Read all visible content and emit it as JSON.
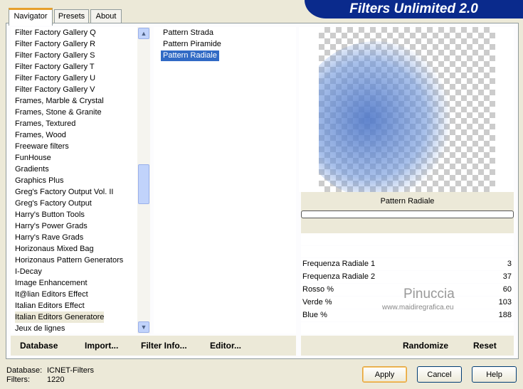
{
  "title": "Filters Unlimited 2.0",
  "tabs": [
    "Navigator",
    "Presets",
    "About"
  ],
  "categories": [
    "Filter Factory Gallery Q",
    "Filter Factory Gallery R",
    "Filter Factory Gallery S",
    "Filter Factory Gallery T",
    "Filter Factory Gallery U",
    "Filter Factory Gallery V",
    "Frames, Marble & Crystal",
    "Frames, Stone & Granite",
    "Frames, Textured",
    "Frames, Wood",
    "Freeware filters",
    "FunHouse",
    "Gradients",
    "Graphics Plus",
    "Greg's Factory Output Vol. II",
    "Greg's Factory Output",
    "Harry's Button Tools",
    "Harry's Power Grads",
    "Harry's Rave Grads",
    "Horizonaus Mixed Bag",
    "Horizonaus Pattern Generators",
    "I-Decay",
    "Image Enhancement",
    "It@lian Editors Effect",
    "Italian Editors Effect",
    "Italian Editors Generatore",
    "Jeux de lignes"
  ],
  "filters": [
    "Pattern  Strada",
    "Pattern Piramide",
    "Pattern Radiale"
  ],
  "preview_label": "Pattern Radiale",
  "params": [
    {
      "label": "Frequenza Radiale 1",
      "value": "3"
    },
    {
      "label": "Frequenza Radiale 2",
      "value": "37"
    },
    {
      "label": "Rosso %",
      "value": "60"
    },
    {
      "label": "Verde %",
      "value": "103"
    },
    {
      "label": "Blue %",
      "value": "188"
    }
  ],
  "watermark": {
    "name": "Pinuccia",
    "site": "www.maidiregrafica.eu"
  },
  "bottom": {
    "database": "Database",
    "import": "Import...",
    "filter_info": "Filter Info...",
    "editor": "Editor...",
    "randomize": "Randomize",
    "reset": "Reset"
  },
  "status": {
    "db_label": "Database:",
    "db_value": "ICNET-Filters",
    "filters_label": "Filters:",
    "filters_value": "1220"
  },
  "buttons": {
    "apply": "Apply",
    "cancel": "Cancel",
    "help": "Help"
  }
}
